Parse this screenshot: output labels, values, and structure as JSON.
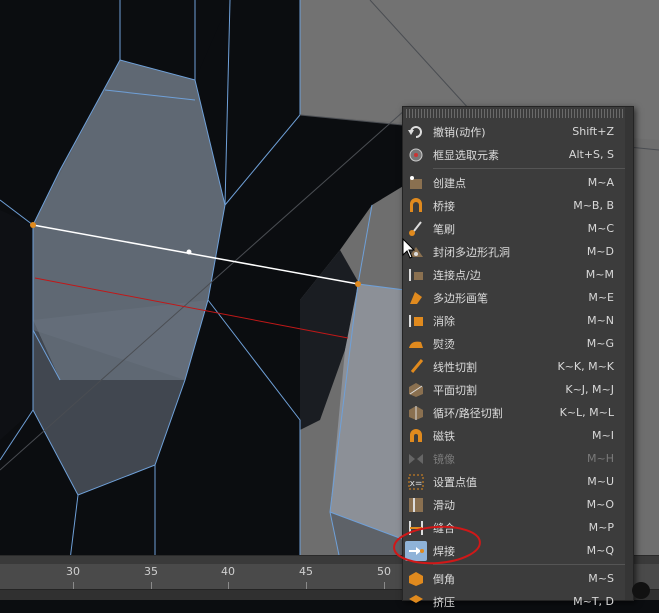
{
  "timeline": {
    "ticks": [
      "30",
      "35",
      "40",
      "45",
      "50"
    ]
  },
  "menu": {
    "items": [
      {
        "label": "撤销(动作)",
        "shortcut": "Shift+Z",
        "icon": "undo-icon"
      },
      {
        "label": "框显选取元素",
        "shortcut": "Alt+S, S",
        "icon": "frame-selection-icon"
      },
      {
        "label": "创建点",
        "shortcut": "M~A",
        "icon": "create-point-icon"
      },
      {
        "label": "桥接",
        "shortcut": "M~B, B",
        "icon": "bridge-icon"
      },
      {
        "label": "笔刷",
        "shortcut": "M~C",
        "icon": "brush-icon"
      },
      {
        "label": "封闭多边形孔洞",
        "shortcut": "M~D",
        "icon": "close-polygon-hole-icon"
      },
      {
        "label": "连接点/边",
        "shortcut": "M~M",
        "icon": "connect-points-edges-icon"
      },
      {
        "label": "多边形画笔",
        "shortcut": "M~E",
        "icon": "polygon-pen-icon"
      },
      {
        "label": "消除",
        "shortcut": "M~N",
        "icon": "dissolve-icon"
      },
      {
        "label": "熨烫",
        "shortcut": "M~G",
        "icon": "iron-icon"
      },
      {
        "label": "线性切割",
        "shortcut": "K~K, M~K",
        "icon": "line-cut-icon"
      },
      {
        "label": "平面切割",
        "shortcut": "K~J, M~J",
        "icon": "plane-cut-icon"
      },
      {
        "label": "循环/路径切割",
        "shortcut": "K~L, M~L",
        "icon": "loop-path-cut-icon"
      },
      {
        "label": "磁铁",
        "shortcut": "M~I",
        "icon": "magnet-icon"
      },
      {
        "label": "镜像",
        "shortcut": "M~H",
        "icon": "mirror-icon"
      },
      {
        "label": "设置点值",
        "shortcut": "M~U",
        "icon": "set-point-value-icon"
      },
      {
        "label": "滑动",
        "shortcut": "M~O",
        "icon": "slide-icon"
      },
      {
        "label": "缝合",
        "shortcut": "M~P",
        "icon": "stitch-icon"
      },
      {
        "label": "焊接",
        "shortcut": "M~Q",
        "icon": "weld-icon"
      },
      {
        "label": "倒角",
        "shortcut": "M~S",
        "icon": "bevel-icon"
      },
      {
        "label": "挤压",
        "shortcut": "M~T, D",
        "icon": "extrude-icon"
      }
    ]
  },
  "colors": {
    "accent_orange": "#e08a1e",
    "annotation_red": "#d01818",
    "mesh_edge": "#6fa0d8"
  }
}
